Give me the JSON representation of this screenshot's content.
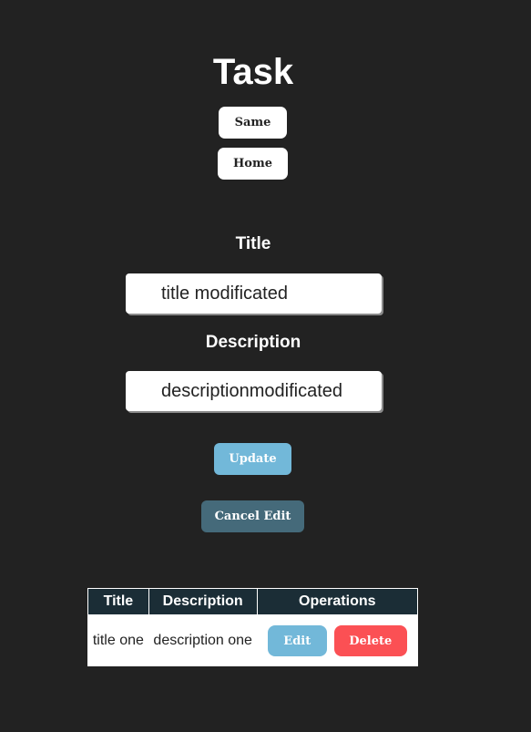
{
  "header": {
    "title": "Task",
    "same_label": "Same",
    "home_label": "Home"
  },
  "form": {
    "title_label": "Title",
    "title_value": "title modificated",
    "description_label": "Description",
    "description_value": "descriptionmodificated",
    "update_label": "Update",
    "cancel_label": "Cancel Edit"
  },
  "table": {
    "headers": [
      "Title",
      "Description",
      "Operations"
    ],
    "rows": [
      {
        "title": "title one",
        "description": "description one",
        "edit_label": "Edit",
        "delete_label": "Delete"
      }
    ]
  },
  "colors": {
    "background": "#222222",
    "update_button": "#72b8d9",
    "cancel_button": "#456a7a",
    "table_header": "#1b2d36",
    "delete_button": "#fb5054"
  }
}
